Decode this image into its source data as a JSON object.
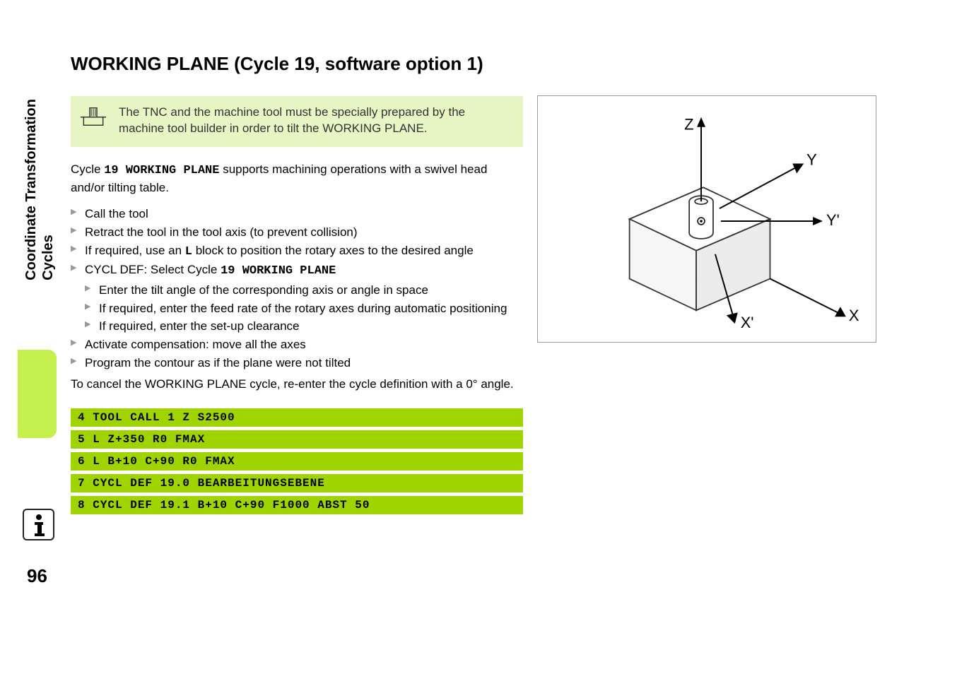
{
  "sidebar": {
    "title_line1": "Coordinate Transformation",
    "title_line2": "Cycles"
  },
  "page_number": "96",
  "heading": "WORKING PLANE (Cycle 19, software option 1)",
  "note": "The TNC and the machine tool must be specially prepared by the machine tool builder in order to tilt the WORKING PLANE.",
  "intro_pre": "Cycle ",
  "intro_mono": "19 WORKING PLANE",
  "intro_post": " supports machining operations with a swivel head and/or tilting table.",
  "bullets": {
    "b1": "Call the tool",
    "b2": "Retract the tool in the tool axis (to prevent collision)",
    "b3_pre": "If required, use an ",
    "b3_mono": "L",
    "b3_post": " block to position the rotary axes to the desired angle",
    "b4_pre": "CYCL DEF: Select Cycle ",
    "b4_mono": "19 WORKING PLANE",
    "b4_sub1": "Enter the tilt angle of the corresponding axis or angle in space",
    "b4_sub2": "If required, enter the feed rate of the rotary axes during automatic positioning",
    "b4_sub3": "If required, enter the set-up clearance",
    "b5": "Activate compensation: move all the axes",
    "b6": "Program the contour as if the plane were not tilted"
  },
  "cancel_text": "To cancel the WORKING PLANE cycle, re-enter the cycle definition with a 0° angle.",
  "code": {
    "l1": "4 TOOL CALL 1 Z S2500",
    "l2": "5 L Z+350 R0 FMAX",
    "l3": "6 L B+10 C+90 R0 FMAX",
    "l4": "7 CYCL DEF 19.0 BEARBEITUNGSEBENE",
    "l5": "8 CYCL DEF 19.1 B+10 C+90 F1000 ABST 50"
  },
  "diagram": {
    "labels": {
      "Z": "Z",
      "Y": "Y",
      "Yprime": "Y'",
      "X": "X",
      "Xprime": "X'"
    }
  }
}
